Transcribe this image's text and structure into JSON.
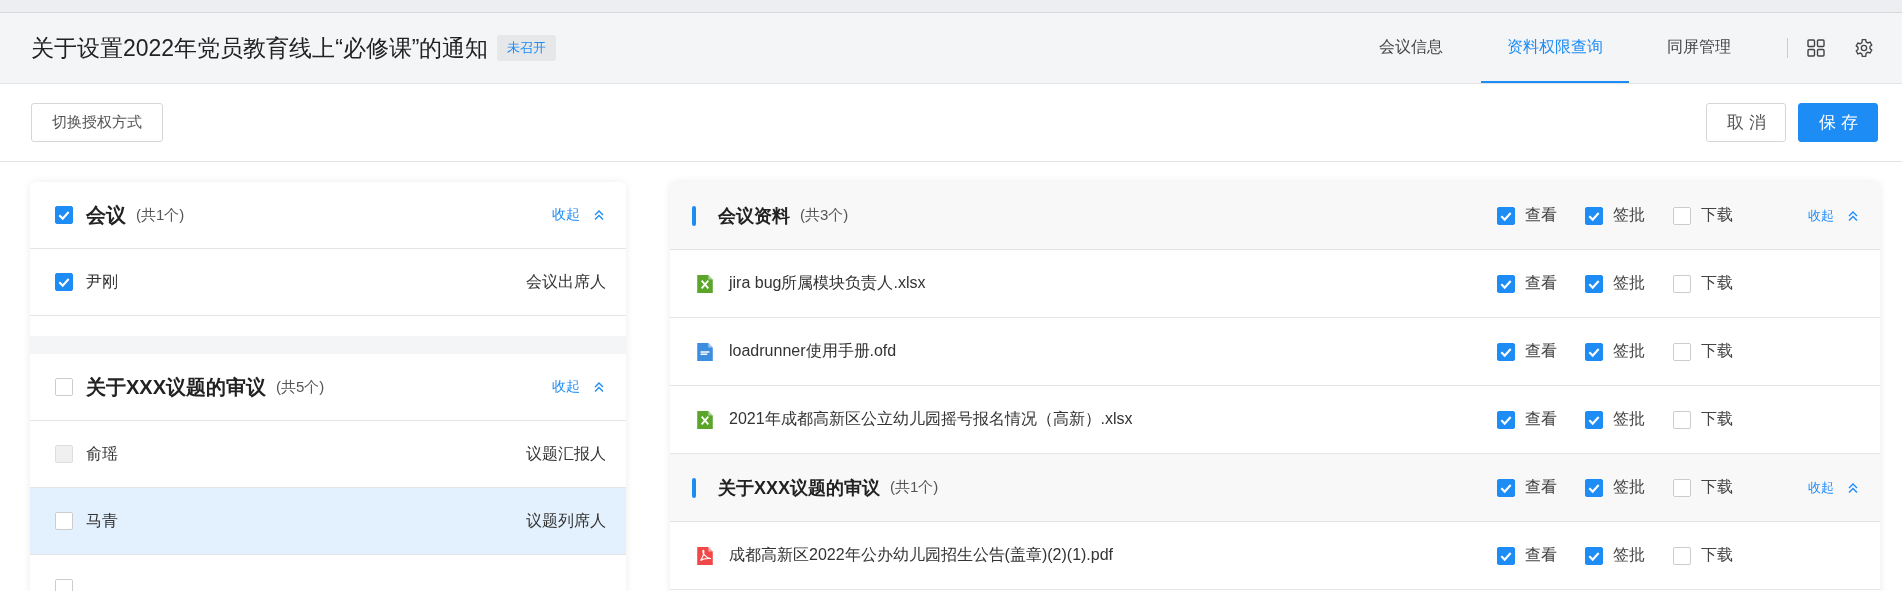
{
  "header": {
    "title": "关于设置2022年党员教育线上“必修课”的通知",
    "status": "未召开",
    "tabs": [
      {
        "label": "会议信息",
        "selected": false
      },
      {
        "label": "资料权限查询",
        "selected": true
      },
      {
        "label": "同屏管理",
        "selected": false
      }
    ]
  },
  "toolbar": {
    "switch_button": "切换授权方式",
    "cancel_button": "取消",
    "save_button": "保存"
  },
  "participants": [
    {
      "title": "会议",
      "count": "(共1个)",
      "checked": true,
      "collapse": "收起",
      "members": [
        {
          "name": "尹刚",
          "role": "会议出席人",
          "checked": true,
          "disabled": false,
          "selected": false
        }
      ]
    },
    {
      "title": "关于XXX议题的审议",
      "count": "(共5个)",
      "checked": false,
      "collapse": "收起",
      "members": [
        {
          "name": "俞瑶",
          "role": "议题汇报人",
          "checked": false,
          "disabled": true,
          "selected": false
        },
        {
          "name": "马青",
          "role": "议题列席人",
          "checked": false,
          "disabled": false,
          "selected": true
        },
        {
          "checked": false,
          "disabled": false,
          "selected": false
        }
      ]
    }
  ],
  "materials": [
    {
      "title": "会议资料",
      "count": "(共3个)",
      "collapse": "收起",
      "permissions": [
        {
          "label": "查看",
          "checked": true
        },
        {
          "label": "签批",
          "checked": true
        },
        {
          "label": "下载",
          "checked": false
        }
      ],
      "files": [
        {
          "name": "jira bug所属模块负责人.xlsx",
          "kind": "xlsx",
          "permissions": [
            {
              "label": "查看",
              "checked": true
            },
            {
              "label": "签批",
              "checked": true
            },
            {
              "label": "下载",
              "checked": false
            }
          ]
        },
        {
          "name": "loadrunner使用手册.ofd",
          "kind": "ofd",
          "permissions": [
            {
              "label": "查看",
              "checked": true
            },
            {
              "label": "签批",
              "checked": true
            },
            {
              "label": "下载",
              "checked": false
            }
          ]
        },
        {
          "name": "2021年成都高新区公立幼儿园摇号报名情况（高新）.xlsx",
          "kind": "xlsx",
          "permissions": [
            {
              "label": "查看",
              "checked": true
            },
            {
              "label": "签批",
              "checked": true
            },
            {
              "label": "下载",
              "checked": false
            }
          ]
        }
      ]
    },
    {
      "title": "关于XXX议题的审议",
      "count": "(共1个)",
      "collapse": "收起",
      "permissions": [
        {
          "label": "查看",
          "checked": true
        },
        {
          "label": "签批",
          "checked": true
        },
        {
          "label": "下载",
          "checked": false
        }
      ],
      "files": [
        {
          "name": "成都高新区2022年公办幼儿园招生公告(盖章)(2)(1).pdf",
          "kind": "pdf",
          "permissions": [
            {
              "label": "查看",
              "checked": true
            },
            {
              "label": "签批",
              "checked": true
            },
            {
              "label": "下载",
              "checked": false
            }
          ]
        }
      ]
    }
  ]
}
